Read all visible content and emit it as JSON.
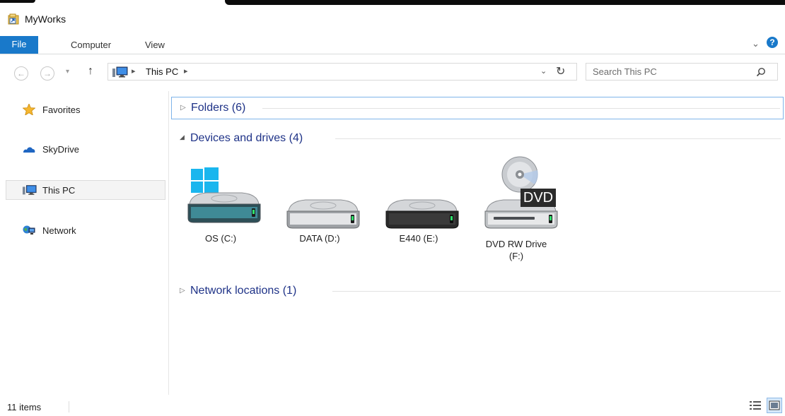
{
  "window": {
    "title": "MyWorks"
  },
  "ribbon": {
    "file_label": "File",
    "tabs": [
      "Computer",
      "View"
    ],
    "help_label": "?"
  },
  "navigation": {
    "address_crumbs": [
      "This PC"
    ],
    "search_placeholder": "Search This PC"
  },
  "sidebar": {
    "items": [
      {
        "label": "Favorites",
        "icon": "star-icon"
      },
      {
        "label": "SkyDrive",
        "icon": "cloud-icon"
      },
      {
        "label": "This PC",
        "icon": "computer-icon",
        "selected": true
      },
      {
        "label": "Network",
        "icon": "network-icon"
      }
    ]
  },
  "groups": [
    {
      "title": "Folders (6)",
      "expanded": false,
      "focused": true
    },
    {
      "title": "Devices and drives (4)",
      "expanded": true,
      "focused": false
    },
    {
      "title": "Network locations (1)",
      "expanded": false,
      "focused": false
    }
  ],
  "drives": [
    {
      "label": "OS (C:)",
      "icon": "system-drive-icon"
    },
    {
      "label": "DATA (D:)",
      "icon": "hard-drive-icon"
    },
    {
      "label": "E440 (E:)",
      "icon": "dark-hard-drive-icon"
    },
    {
      "label": "DVD RW Drive (F:)",
      "icon": "dvd-drive-icon",
      "badge": "DVD"
    }
  ],
  "status": {
    "item_count": "11 items"
  },
  "colors": {
    "accent": "#1979ca",
    "group_title": "#1e3287",
    "focus_border": "#7eb4ea"
  }
}
